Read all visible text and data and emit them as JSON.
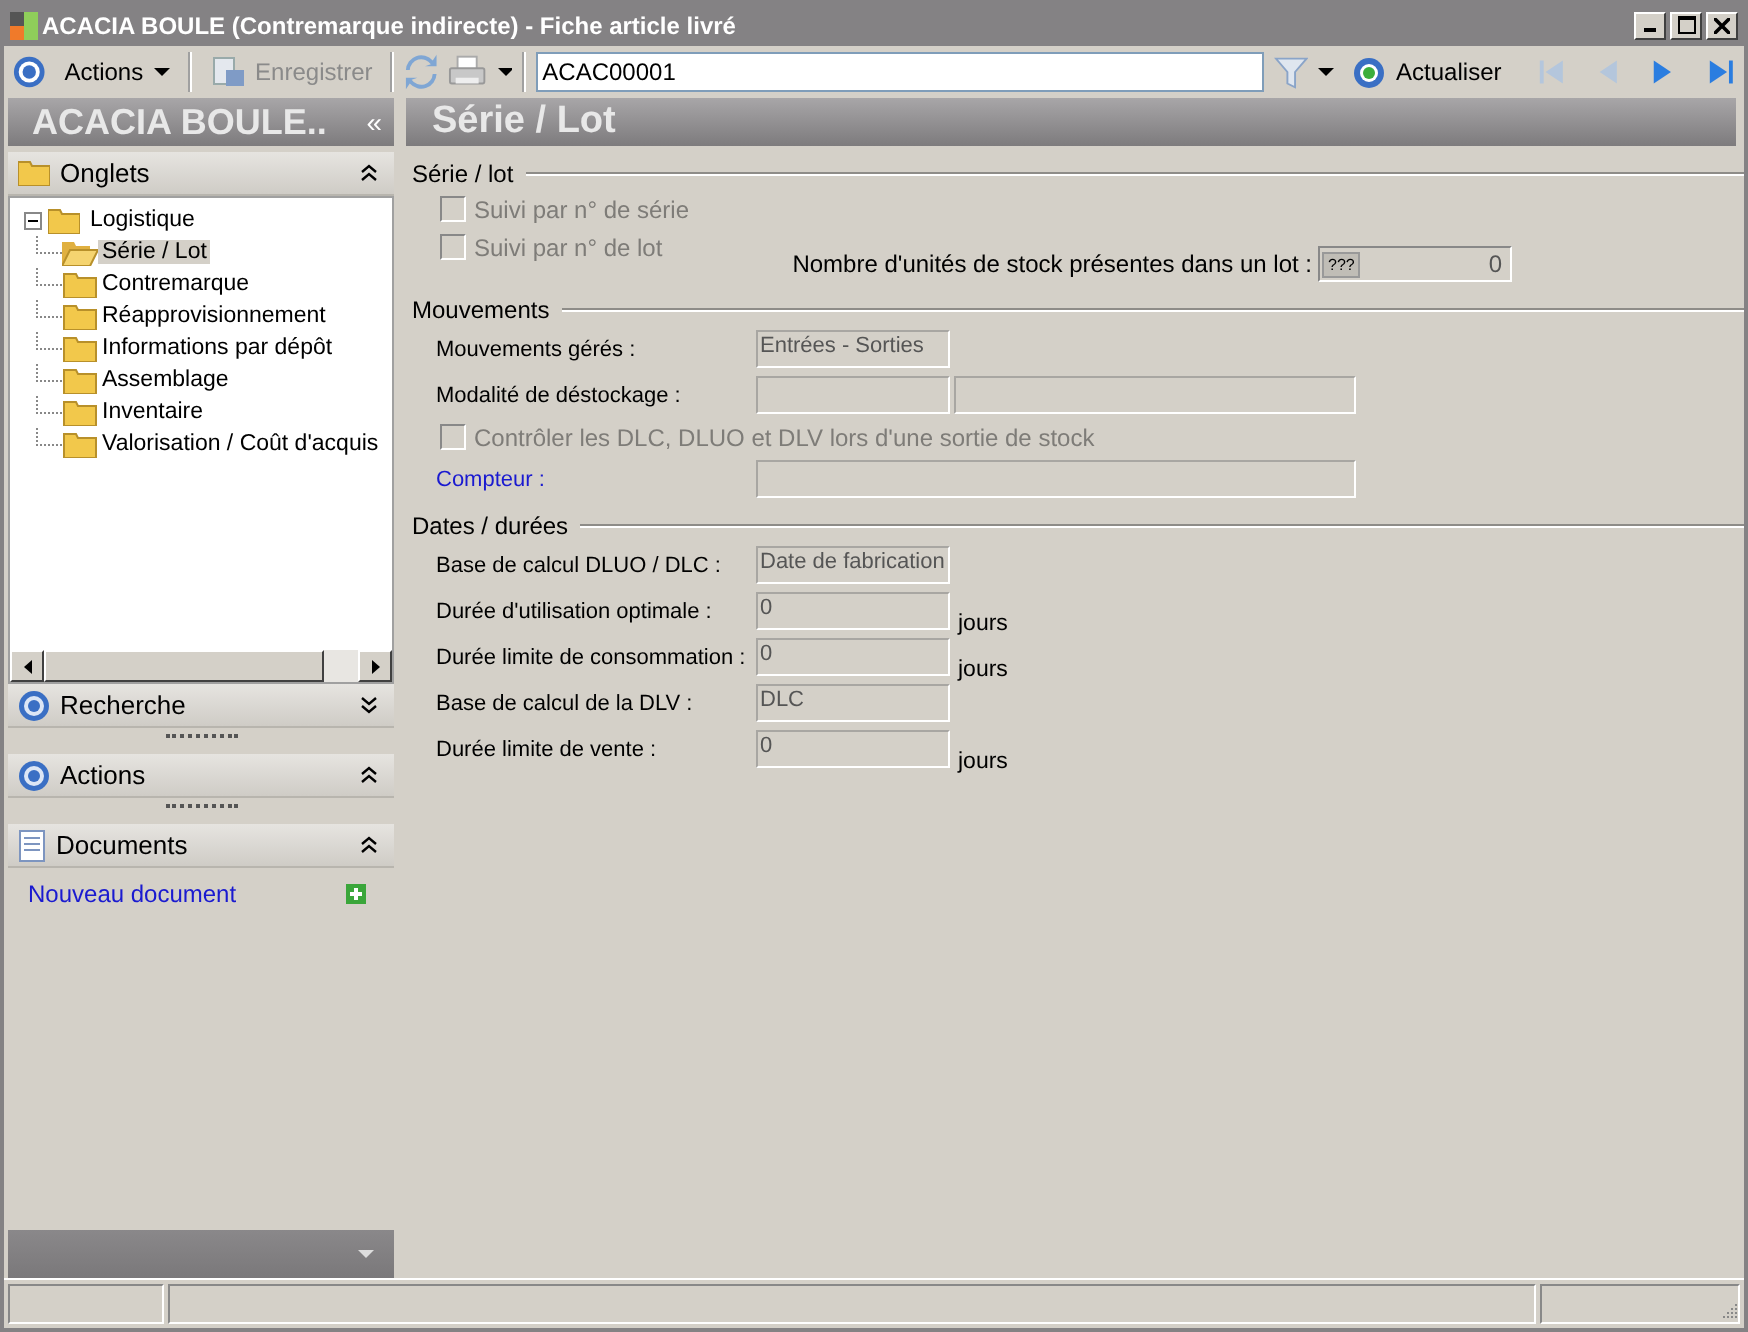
{
  "window": {
    "title": "ACACIA BOULE (Contremarque indirecte) -  Fiche article livré"
  },
  "toolbar": {
    "actions_menu": {
      "label": "Actions"
    },
    "save_button": {
      "label": "Enregistrer",
      "disabled": true
    },
    "record_field": {
      "value": "ACAC00001"
    },
    "refresh_button": {
      "label": "Actualiser"
    },
    "nav_buttons": [
      {
        "kind": "first",
        "disabled": true
      },
      {
        "kind": "prev",
        "disabled": true
      },
      {
        "kind": "next",
        "disabled": false
      },
      {
        "kind": "last",
        "disabled": false
      }
    ]
  },
  "sidebar": {
    "title": "ACACIA BOULE..",
    "collapse_glyph": "«",
    "panels": [
      {
        "kind": "tree",
        "title": "Onglets",
        "expanded": true
      },
      {
        "kind": "search",
        "title": "Recherche",
        "expanded": false
      },
      {
        "kind": "actions",
        "title": "Actions",
        "expanded": true
      },
      {
        "kind": "documents",
        "title": "Documents",
        "expanded": true
      }
    ],
    "tree": [
      {
        "label": "Logistique",
        "expanded": true,
        "children": [
          {
            "label": "Série / Lot",
            "selected": true
          },
          {
            "label": "Contremarque",
            "selected": false
          },
          {
            "label": "Réapprovisionnement",
            "selected": false
          },
          {
            "label": "Informations par dépôt",
            "selected": false
          },
          {
            "label": "Assemblage",
            "selected": false
          },
          {
            "label": "Inventaire",
            "selected": false
          },
          {
            "label": "Valorisation / Coût d'acquis",
            "selected": false
          }
        ]
      }
    ],
    "new_document_link": "Nouveau document"
  },
  "page": {
    "title": "Série / Lot",
    "sections": [
      {
        "title": "Série / lot",
        "rows": [
          {
            "kind": "checkbox",
            "label": "Suivi par n° de série",
            "checked": false,
            "disabled": true
          },
          {
            "kind": "checkbox",
            "label": "Suivi par n° de lot",
            "checked": false,
            "disabled": true
          },
          {
            "kind": "unit_count",
            "label": "Nombre d'unités de stock présentes dans un lot :",
            "button": "???",
            "value": "0"
          }
        ]
      },
      {
        "title": "Mouvements",
        "rows": [
          {
            "kind": "field",
            "label": "Mouvements gérés :",
            "value": "Entrées - Sorties"
          },
          {
            "kind": "double_field",
            "label": "Modalité de déstockage :"
          },
          {
            "kind": "checkbox",
            "label": "Contrôler les DLC, DLUO et DLV lors d'une sortie de stock",
            "checked": false,
            "disabled": true
          },
          {
            "kind": "link_field",
            "label": "Compteur :"
          }
        ]
      },
      {
        "title": "Dates / durées",
        "rows": [
          {
            "kind": "field",
            "label": "Base de calcul DLUO / DLC :",
            "value": "Date de fabrication"
          },
          {
            "kind": "field",
            "label": "Durée d'utilisation optimale :",
            "value": "0",
            "unit": "jours"
          },
          {
            "kind": "field",
            "label": "Durée limite de consommation :",
            "value": "0",
            "unit": "jours"
          },
          {
            "kind": "field",
            "label": "Base de calcul de la DLV :",
            "value": "DLC"
          },
          {
            "kind": "field",
            "label": "Durée limite de vente :",
            "value": "0",
            "unit": "jours"
          }
        ]
      }
    ]
  }
}
